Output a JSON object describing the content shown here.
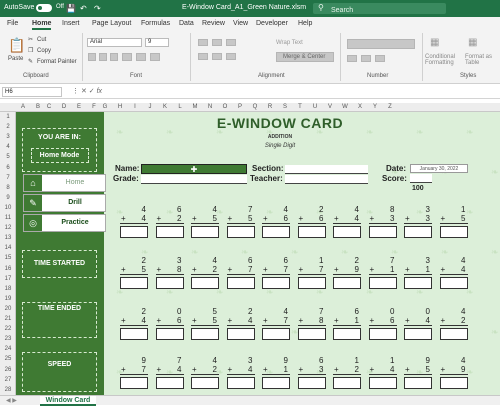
{
  "titlebar": {
    "autosave": "AutoSave",
    "toggle_state": "Off",
    "filename": "E-Window Card_A1_Green Nature.xlsm",
    "search_placeholder": "Search"
  },
  "menu": [
    "File",
    "Home",
    "Insert",
    "Page Layout",
    "Formulas",
    "Data",
    "Review",
    "View",
    "Developer",
    "Help"
  ],
  "ribbon": {
    "paste": "Paste",
    "cut": "Cut",
    "copy": "Copy",
    "format_painter": "Format Painter",
    "font_name": "Arial",
    "font_size": "9",
    "wrap_text": "Wrap Text",
    "merge_center": "Merge & Center",
    "conditional_formatting": "Conditional Formatting",
    "format_as_table": "Format as Table",
    "groups": {
      "clipboard": "Clipboard",
      "font": "Font",
      "alignment": "Alignment",
      "number": "Number",
      "styles": "Styles"
    }
  },
  "formula_bar": {
    "cell_ref": "H6"
  },
  "columns": [
    "A",
    "B",
    "C",
    "D",
    "E",
    "F",
    "G",
    "H",
    "I",
    "J",
    "K",
    "L",
    "M",
    "N",
    "O",
    "P",
    "Q",
    "R",
    "S",
    "T",
    "U",
    "V",
    "W",
    "X",
    "Y",
    "Z"
  ],
  "rows": [
    "1",
    "2",
    "3",
    "4",
    "5",
    "6",
    "7",
    "8",
    "9",
    "10",
    "11",
    "12",
    "13",
    "14",
    "15",
    "16",
    "17",
    "18",
    "19",
    "20",
    "21",
    "22",
    "23",
    "24",
    "25",
    "26",
    "27",
    "28"
  ],
  "sidebar": {
    "you_are_in": "YOU ARE IN:",
    "mode": "Home Mode",
    "buttons": [
      {
        "label": "Home",
        "icon": "house-icon"
      },
      {
        "label": "Drill",
        "icon": "pencil-icon"
      },
      {
        "label": "Practice",
        "icon": "target-icon"
      }
    ],
    "time_started": "TIME STARTED",
    "time_ended": "TIME ENDED",
    "speed": "SPEED"
  },
  "card": {
    "title": "E-WINDOW CARD",
    "operation": "ADDITION",
    "level": "Single Digit",
    "name_label": "Name:",
    "name_value": "",
    "grade_label": "Grade:",
    "section_label": "Section:",
    "teacher_label": "Teacher:",
    "date_label": "Date:",
    "date_value": "January 30, 2022",
    "score_label": "Score:",
    "score_max": "100"
  },
  "problems": [
    [
      {
        "a": "4",
        "b": "4"
      },
      {
        "a": "6",
        "b": "2"
      },
      {
        "a": "4",
        "b": "5"
      },
      {
        "a": "7",
        "b": "5"
      },
      {
        "a": "4",
        "b": "6"
      },
      {
        "a": "2",
        "b": "6"
      },
      {
        "a": "4",
        "b": "4"
      },
      {
        "a": "8",
        "b": "3"
      },
      {
        "a": "3",
        "b": "3"
      },
      {
        "a": "1",
        "b": "5"
      }
    ],
    [
      {
        "a": "2",
        "b": "5"
      },
      {
        "a": "3",
        "b": "8"
      },
      {
        "a": "4",
        "b": "2"
      },
      {
        "a": "6",
        "b": "7"
      },
      {
        "a": "6",
        "b": "7"
      },
      {
        "a": "1",
        "b": "7"
      },
      {
        "a": "2",
        "b": "9"
      },
      {
        "a": "7",
        "b": "1"
      },
      {
        "a": "3",
        "b": "1"
      },
      {
        "a": "4",
        "b": "4"
      }
    ],
    [
      {
        "a": "2",
        "b": "4"
      },
      {
        "a": "0",
        "b": "6"
      },
      {
        "a": "5",
        "b": "5"
      },
      {
        "a": "2",
        "b": "4"
      },
      {
        "a": "4",
        "b": "7"
      },
      {
        "a": "7",
        "b": "8"
      },
      {
        "a": "6",
        "b": "1"
      },
      {
        "a": "0",
        "b": "6"
      },
      {
        "a": "0",
        "b": "4"
      },
      {
        "a": "4",
        "b": "2"
      }
    ],
    [
      {
        "a": "9",
        "b": "7"
      },
      {
        "a": "7",
        "b": "4"
      },
      {
        "a": "4",
        "b": "2"
      },
      {
        "a": "3",
        "b": "4"
      },
      {
        "a": "9",
        "b": "1"
      },
      {
        "a": "6",
        "b": "3"
      },
      {
        "a": "1",
        "b": "2"
      },
      {
        "a": "1",
        "b": "4"
      },
      {
        "a": "9",
        "b": "5"
      },
      {
        "a": "4",
        "b": "9"
      }
    ]
  ],
  "sheet_tab": "Window Card"
}
